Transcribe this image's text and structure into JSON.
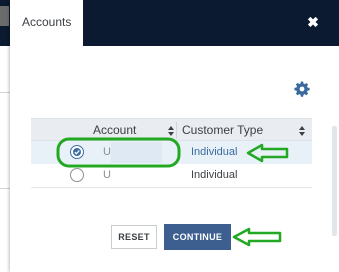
{
  "modal": {
    "tab_label": "Accounts",
    "close_glyph": "✖"
  },
  "table": {
    "columns": [
      "Account",
      "Customer Type"
    ],
    "rows": [
      {
        "account": "U",
        "customer_type": "Individual",
        "selected": true
      },
      {
        "account": "U",
        "customer_type": "Individual",
        "selected": false
      }
    ]
  },
  "actions": {
    "reset_label": "RESET",
    "continue_label": "CONTINUE"
  },
  "colors": {
    "header_bg": "#0b1a30",
    "primary": "#3d5f8f",
    "annotation": "#22a822"
  },
  "icons": {
    "settings": "gear-icon",
    "close": "close-icon",
    "sort": "sort-icon",
    "radio_checked": "radio-checked-icon"
  }
}
